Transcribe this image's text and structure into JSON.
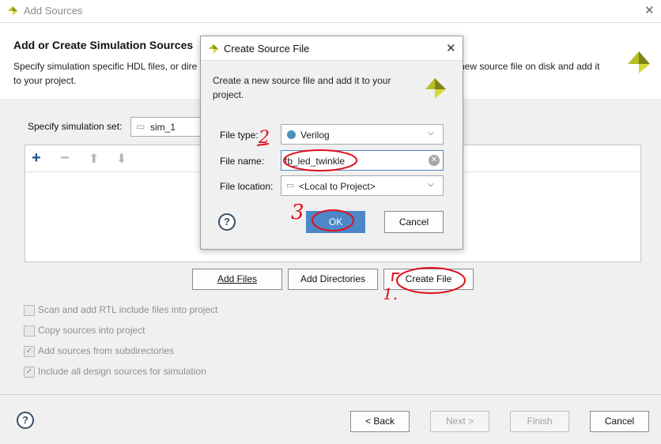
{
  "window": {
    "title": "Add Sources",
    "close_glyph": "✕"
  },
  "header": {
    "title": "Add or Create Simulation Sources",
    "desc_left": "Specify simulation specific HDL files, or dire",
    "desc_right": "new source file on disk and add it",
    "desc_line2": "to your project."
  },
  "sim_set": {
    "label": "Specify simulation set:",
    "value": "sim_1"
  },
  "file_buttons": {
    "add_files": "Add Files",
    "add_directories": "Add Directories",
    "create_file": "Create File"
  },
  "options": [
    {
      "label": "Scan and add RTL include files into project",
      "checked": false
    },
    {
      "label": "Copy sources into project",
      "checked": false
    },
    {
      "label": "Add sources from subdirectories",
      "checked": true
    },
    {
      "label": "Include all design sources for simulation",
      "checked": true
    }
  ],
  "footer": {
    "help": "?",
    "back": "< Back",
    "next": "Next >",
    "finish": "Finish",
    "cancel": "Cancel"
  },
  "dialog": {
    "title": "Create Source File",
    "close_glyph": "✕",
    "desc": "Create a new source file and add it to your project.",
    "file_type": {
      "label": "File type:",
      "value": "Verilog",
      "dot_color": "#4a90b8"
    },
    "file_name": {
      "label": "File name:",
      "value": "tb_led_twinkle"
    },
    "file_location": {
      "label": "File location:",
      "value": "<Local to Project>"
    },
    "help": "?",
    "ok": "OK",
    "cancel": "Cancel"
  },
  "annotations": {
    "mark_1": "1.",
    "mark_2": "2",
    "mark_3": "3"
  },
  "colors": {
    "accent": "#4d87c7",
    "logo": "#c2c629",
    "annotation": "#e0101a"
  }
}
